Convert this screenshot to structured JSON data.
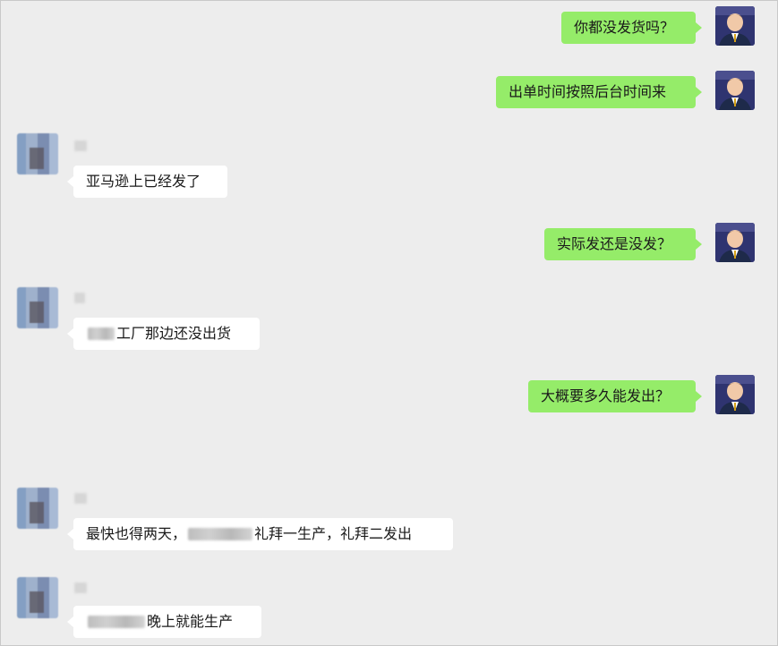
{
  "messages": [
    {
      "side": "out",
      "text": "你都没发货吗？"
    },
    {
      "side": "out",
      "text": "出单时间按照后台时间来"
    },
    {
      "side": "in",
      "text": "亚马逊上已经发了"
    },
    {
      "side": "out",
      "text": "实际发还是没发？"
    },
    {
      "side": "in",
      "text": "工厂那边还没出货"
    },
    {
      "side": "out",
      "text": "大概要多久能发出？"
    },
    {
      "side": "in",
      "text_before": "最快也得两天，",
      "text_after": "礼拜一生产，礼拜二发出"
    },
    {
      "side": "in",
      "text": "晚上就能生产"
    }
  ]
}
